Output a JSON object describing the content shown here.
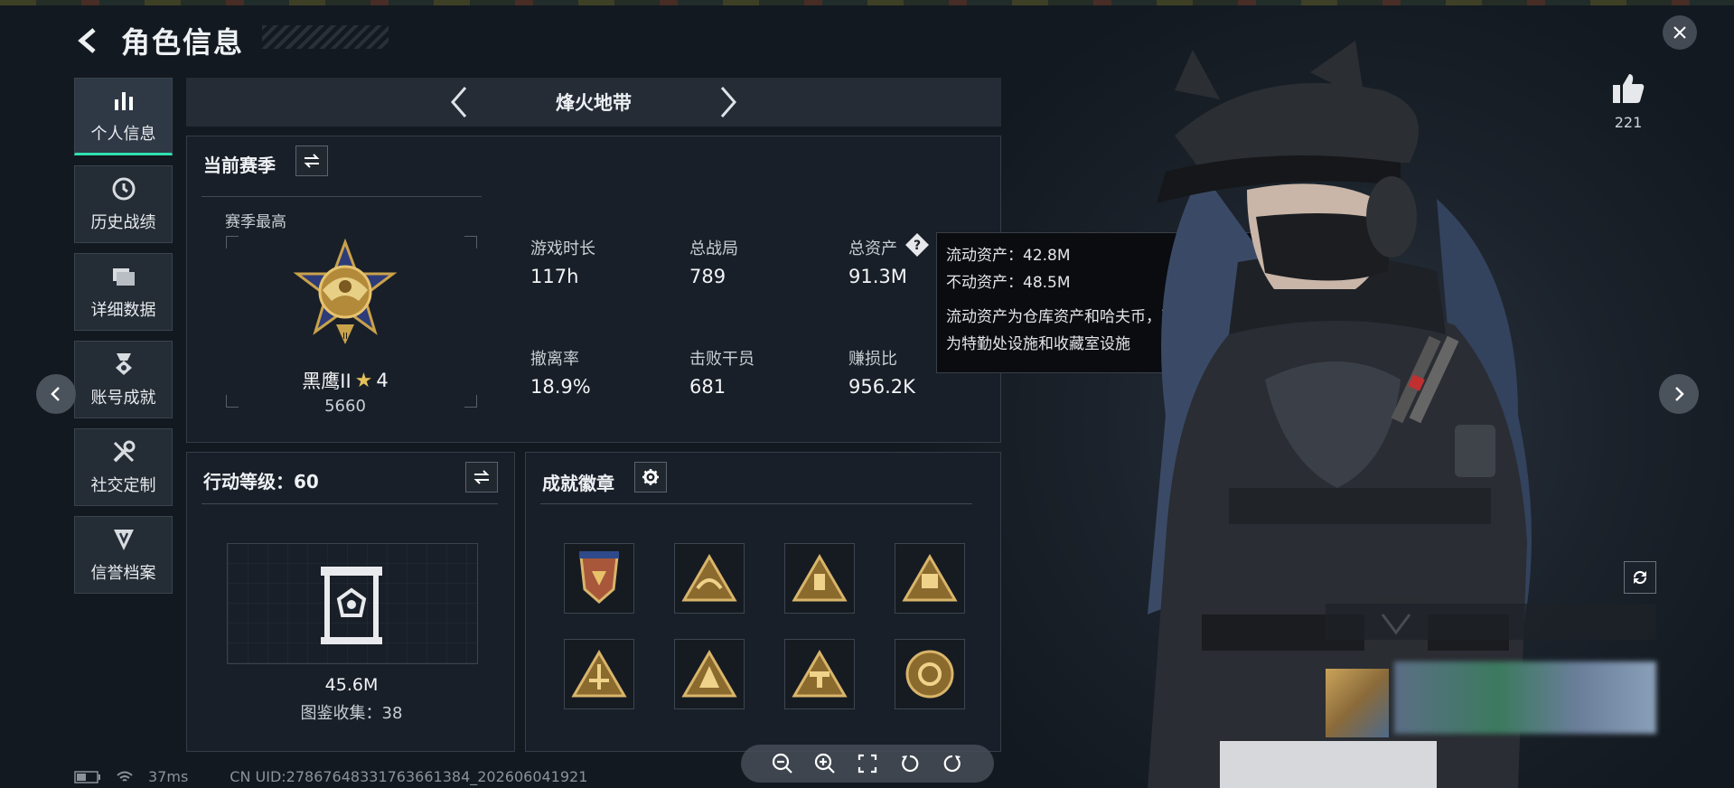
{
  "header": {
    "title": "角色信息"
  },
  "nav": [
    {
      "id": "personal",
      "label": "个人信息",
      "icon": "bar-chart-icon",
      "active": true
    },
    {
      "id": "history",
      "label": "历史战绩",
      "icon": "history-clock-icon",
      "active": false
    },
    {
      "id": "details",
      "label": "详细数据",
      "icon": "folder-icon",
      "active": false
    },
    {
      "id": "achievements",
      "label": "账号成就",
      "icon": "medal-icon",
      "active": false
    },
    {
      "id": "social",
      "label": "社交定制",
      "icon": "wrench-icon",
      "active": false
    },
    {
      "id": "credit",
      "label": "信誉档案",
      "icon": "shield-icon",
      "active": false
    }
  ],
  "mode": {
    "name": "烽火地带"
  },
  "season": {
    "title": "当前赛季",
    "best_label": "赛季最高",
    "rank_name": "黑鹰II",
    "rank_stars": "4",
    "rank_score": "5660",
    "stats": [
      {
        "label": "游戏时长",
        "value": "117h"
      },
      {
        "label": "总战局",
        "value": "789"
      },
      {
        "label": "总资产",
        "value": "91.3M"
      },
      {
        "label": "撤离率",
        "value": "18.9%"
      },
      {
        "label": "击败干员",
        "value": "681"
      },
      {
        "label": "赚损比",
        "value": "956.2K"
      }
    ]
  },
  "tooltip": {
    "liquid": "流动资产：42.8M",
    "fixed": "不动资产：48.5M",
    "desc_line1": "流动资产为仓库资产和哈夫币，不动资产",
    "desc_line2": "为特勤处设施和收藏室设施"
  },
  "action_level": {
    "title": "行动等级：60",
    "value": "45.6M",
    "collection": "图鉴收集：38"
  },
  "badges": {
    "title": "成就徽章",
    "items": [
      "badge-1",
      "badge-2",
      "badge-3",
      "badge-4",
      "badge-5",
      "badge-6",
      "badge-7",
      "badge-8"
    ]
  },
  "like": {
    "count": "221"
  },
  "status": {
    "ping": "37ms",
    "uid": "CN UID:2786764833176366138​4_202606041921"
  },
  "colors": {
    "accent": "#2ee0b0",
    "gold": "#c9a24a"
  }
}
